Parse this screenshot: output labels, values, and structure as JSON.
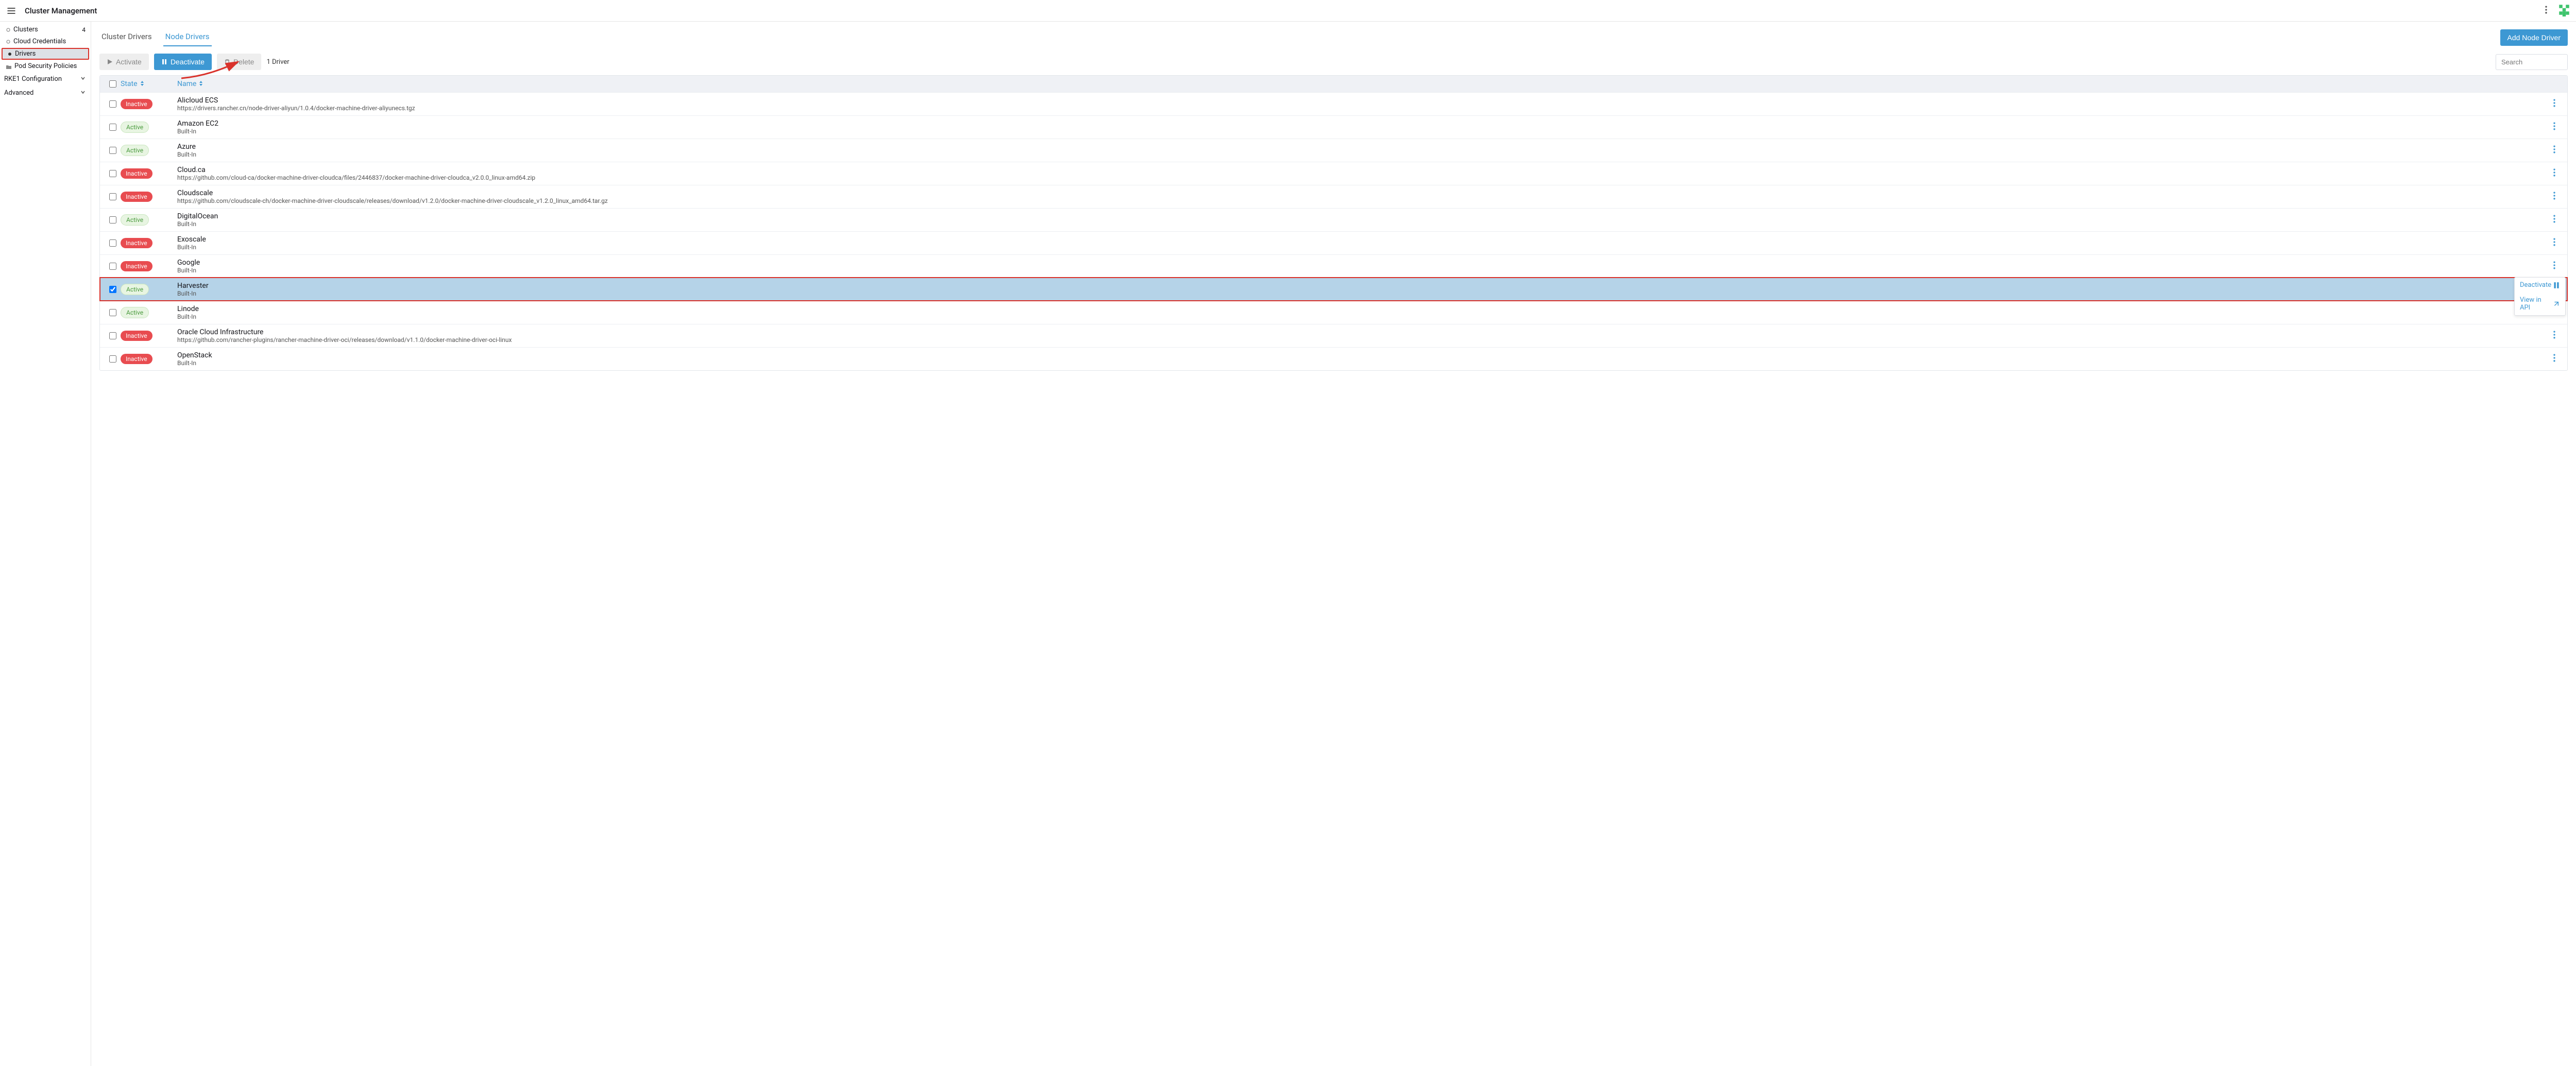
{
  "header": {
    "title": "Cluster Management"
  },
  "sidebar": {
    "items": [
      {
        "label": "Clusters",
        "badge": "4",
        "icon": "circle",
        "active": false
      },
      {
        "label": "Cloud Credentials",
        "icon": "circle",
        "active": false
      },
      {
        "label": "Drivers",
        "icon": "circle-filled",
        "active": true
      },
      {
        "label": "Pod Security Policies",
        "icon": "folder",
        "active": false
      }
    ],
    "groups": [
      {
        "label": "RKE1 Configuration"
      },
      {
        "label": "Advanced"
      }
    ]
  },
  "tabs": {
    "cluster": "Cluster Drivers",
    "node": "Node Drivers",
    "active": "Node Drivers"
  },
  "buttons": {
    "add": "Add Node Driver",
    "activate": "Activate",
    "deactivate": "Deactivate",
    "delete": "Delete"
  },
  "table": {
    "count": "1 Driver",
    "search_placeholder": "Search",
    "headers": {
      "state": "State",
      "name": "Name"
    },
    "rows": [
      {
        "state": "Inactive",
        "name": "Alicloud ECS",
        "sub": "https://drivers.rancher.cn/node-driver-aliyun/1.0.4/docker-machine-driver-aliyunecs.tgz",
        "checked": false
      },
      {
        "state": "Active",
        "name": "Amazon EC2",
        "sub": "Built-In",
        "checked": false
      },
      {
        "state": "Active",
        "name": "Azure",
        "sub": "Built-In",
        "checked": false
      },
      {
        "state": "Inactive",
        "name": "Cloud.ca",
        "sub": "https://github.com/cloud-ca/docker-machine-driver-cloudca/files/2446837/docker-machine-driver-cloudca_v2.0.0_linux-amd64.zip",
        "checked": false
      },
      {
        "state": "Inactive",
        "name": "Cloudscale",
        "sub": "https://github.com/cloudscale-ch/docker-machine-driver-cloudscale/releases/download/v1.2.0/docker-machine-driver-cloudscale_v1.2.0_linux_amd64.tar.gz",
        "checked": false
      },
      {
        "state": "Active",
        "name": "DigitalOcean",
        "sub": "Built-In",
        "checked": false
      },
      {
        "state": "Inactive",
        "name": "Exoscale",
        "sub": "Built-In",
        "checked": false
      },
      {
        "state": "Inactive",
        "name": "Google",
        "sub": "Built-In",
        "checked": false
      },
      {
        "state": "Active",
        "name": "Harvester",
        "sub": "Built-In",
        "checked": true
      },
      {
        "state": "Active",
        "name": "Linode",
        "sub": "Built-In",
        "checked": false
      },
      {
        "state": "Inactive",
        "name": "Oracle Cloud Infrastructure",
        "sub": "https://github.com/rancher-plugins/rancher-machine-driver-oci/releases/download/v1.1.0/docker-machine-driver-oci-linux",
        "checked": false
      },
      {
        "state": "Inactive",
        "name": "OpenStack",
        "sub": "Built-In",
        "checked": false
      }
    ]
  },
  "ctx": {
    "deactivate": "Deactivate",
    "view_api": "View in API"
  }
}
